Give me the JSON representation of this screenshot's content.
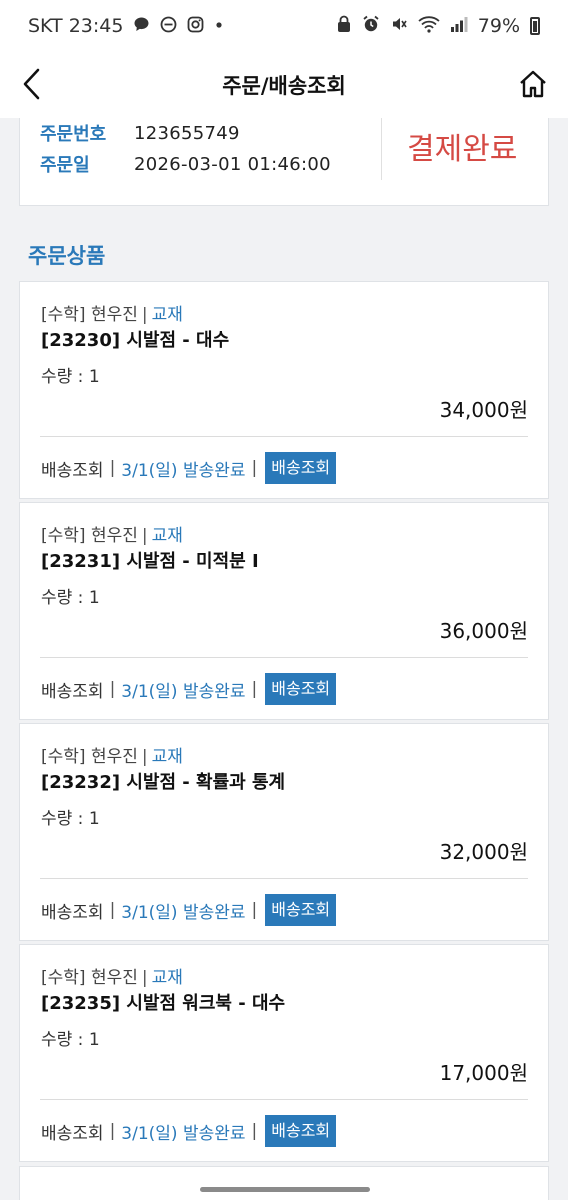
{
  "status_bar": {
    "carrier_time": "SKT 23:45",
    "battery": "79%",
    "left_icons": [
      "chat-bubble-icon",
      "do-not-disturb-icon",
      "instagram-icon",
      "dot-icon"
    ],
    "right_icons": [
      "lock-icon",
      "alarm-icon",
      "mute-icon",
      "wifi-icon",
      "signal-icon",
      "battery-icon"
    ]
  },
  "header": {
    "title": "주문/배송조회",
    "back_icon": "chevron-left-icon",
    "home_icon": "home-icon"
  },
  "order": {
    "number_label": "주문번호",
    "number": "123655749",
    "date_label": "주문일",
    "date": "2026-03-01 01:46:00",
    "status": "결제완료"
  },
  "products_section_title": "주문상품",
  "products": [
    {
      "subject": "[수학]",
      "teacher": "현우진",
      "type": "교재",
      "name": "[23230] 시발점 - 대수",
      "qty": "수량 : 1",
      "price": "34,000원",
      "ship_label": "배송조회",
      "ship_status": "3/1(일) 발송완료",
      "track_button": "배송조회"
    },
    {
      "subject": "[수학]",
      "teacher": "현우진",
      "type": "교재",
      "name": "[23231] 시발점 - 미적분 I",
      "qty": "수량 : 1",
      "price": "36,000원",
      "ship_label": "배송조회",
      "ship_status": "3/1(일) 발송완료",
      "track_button": "배송조회"
    },
    {
      "subject": "[수학]",
      "teacher": "현우진",
      "type": "교재",
      "name": "[23232] 시발점 - 확률과 통계",
      "qty": "수량 : 1",
      "price": "32,000원",
      "ship_label": "배송조회",
      "ship_status": "3/1(일) 발송완료",
      "track_button": "배송조회"
    },
    {
      "subject": "[수학]",
      "teacher": "현우진",
      "type": "교재",
      "name": "[23235] 시발점 워크북 - 대수",
      "qty": "수량 : 1",
      "price": "17,000원",
      "ship_label": "배송조회",
      "ship_status": "3/1(일) 발송완료",
      "track_button": "배송조회"
    }
  ],
  "colors": {
    "accent": "#2a79b9",
    "status_red": "#d54a44",
    "background": "#f1f2f4"
  }
}
